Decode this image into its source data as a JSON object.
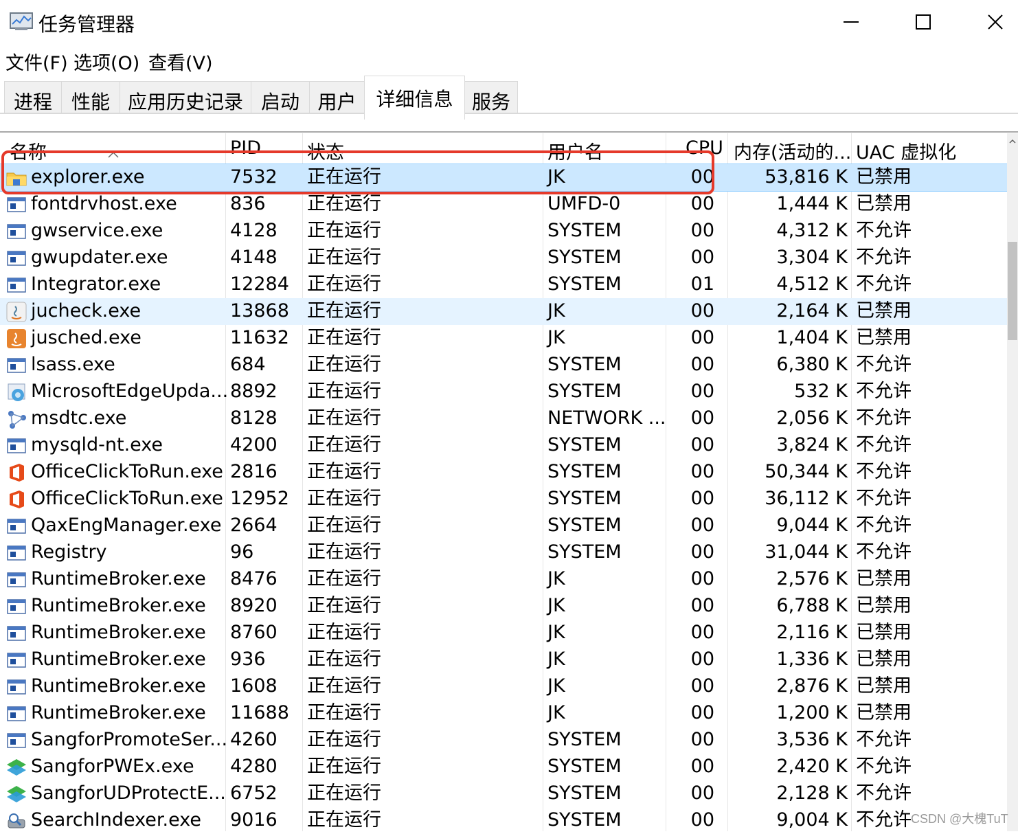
{
  "window": {
    "title": "任务管理器",
    "controls": {
      "minimize": "—",
      "maximize": "☐",
      "close": "✕"
    }
  },
  "menu": [
    "文件(F)",
    "选项(O)",
    "查看(V)"
  ],
  "tabs": [
    {
      "label": "进程",
      "active": false
    },
    {
      "label": "性能",
      "active": false
    },
    {
      "label": "应用历史记录",
      "active": false
    },
    {
      "label": "启动",
      "active": false
    },
    {
      "label": "用户",
      "active": false
    },
    {
      "label": "详细信息",
      "active": true
    },
    {
      "label": "服务",
      "active": false
    }
  ],
  "table": {
    "columns": [
      "名称",
      "PID",
      "状态",
      "用户名",
      "CPU",
      "内存(活动的...",
      "UAC 虚拟化"
    ],
    "sort_column": "名称",
    "sort_direction": "ascending",
    "rows": [
      {
        "icon": "folder-icon",
        "name": "explorer.exe",
        "pid": "7532",
        "status": "正在运行",
        "user": "JK",
        "cpu": "00",
        "mem": "53,816 K",
        "uac": "已禁用",
        "state": "selected"
      },
      {
        "icon": "app-window-icon",
        "name": "fontdrvhost.exe",
        "pid": "836",
        "status": "正在运行",
        "user": "UMFD-0",
        "cpu": "00",
        "mem": "1,444 K",
        "uac": "已禁用",
        "state": ""
      },
      {
        "icon": "app-window-icon",
        "name": "gwservice.exe",
        "pid": "4128",
        "status": "正在运行",
        "user": "SYSTEM",
        "cpu": "00",
        "mem": "4,312 K",
        "uac": "不允许",
        "state": ""
      },
      {
        "icon": "app-window-icon",
        "name": "gwupdater.exe",
        "pid": "4148",
        "status": "正在运行",
        "user": "SYSTEM",
        "cpu": "00",
        "mem": "3,304 K",
        "uac": "不允许",
        "state": ""
      },
      {
        "icon": "app-window-icon",
        "name": "Integrator.exe",
        "pid": "12284",
        "status": "正在运行",
        "user": "SYSTEM",
        "cpu": "01",
        "mem": "4,512 K",
        "uac": "不允许",
        "state": ""
      },
      {
        "icon": "java-icon",
        "name": "jucheck.exe",
        "pid": "13868",
        "status": "正在运行",
        "user": "JK",
        "cpu": "00",
        "mem": "2,164 K",
        "uac": "已禁用",
        "state": "hover"
      },
      {
        "icon": "java-orange-icon",
        "name": "jusched.exe",
        "pid": "11632",
        "status": "正在运行",
        "user": "JK",
        "cpu": "00",
        "mem": "1,404 K",
        "uac": "已禁用",
        "state": ""
      },
      {
        "icon": "app-window-icon",
        "name": "lsass.exe",
        "pid": "684",
        "status": "正在运行",
        "user": "SYSTEM",
        "cpu": "00",
        "mem": "6,380 K",
        "uac": "不允许",
        "state": ""
      },
      {
        "icon": "edge-update-icon",
        "name": "MicrosoftEdgeUpda...",
        "pid": "8892",
        "status": "正在运行",
        "user": "SYSTEM",
        "cpu": "00",
        "mem": "532 K",
        "uac": "不允许",
        "state": ""
      },
      {
        "icon": "network-icon",
        "name": "msdtc.exe",
        "pid": "8128",
        "status": "正在运行",
        "user": "NETWORK ...",
        "cpu": "00",
        "mem": "2,056 K",
        "uac": "不允许",
        "state": ""
      },
      {
        "icon": "app-window-icon",
        "name": "mysqld-nt.exe",
        "pid": "4200",
        "status": "正在运行",
        "user": "SYSTEM",
        "cpu": "00",
        "mem": "3,824 K",
        "uac": "不允许",
        "state": ""
      },
      {
        "icon": "office-icon",
        "name": "OfficeClickToRun.exe",
        "pid": "2816",
        "status": "正在运行",
        "user": "SYSTEM",
        "cpu": "00",
        "mem": "50,344 K",
        "uac": "不允许",
        "state": ""
      },
      {
        "icon": "office-icon",
        "name": "OfficeClickToRun.exe",
        "pid": "12952",
        "status": "正在运行",
        "user": "SYSTEM",
        "cpu": "00",
        "mem": "36,112 K",
        "uac": "不允许",
        "state": ""
      },
      {
        "icon": "app-window-icon",
        "name": "QaxEngManager.exe",
        "pid": "2664",
        "status": "正在运行",
        "user": "SYSTEM",
        "cpu": "00",
        "mem": "9,044 K",
        "uac": "不允许",
        "state": ""
      },
      {
        "icon": "app-window-icon",
        "name": "Registry",
        "pid": "96",
        "status": "正在运行",
        "user": "SYSTEM",
        "cpu": "00",
        "mem": "31,044 K",
        "uac": "不允许",
        "state": ""
      },
      {
        "icon": "app-window-icon",
        "name": "RuntimeBroker.exe",
        "pid": "8476",
        "status": "正在运行",
        "user": "JK",
        "cpu": "00",
        "mem": "2,576 K",
        "uac": "已禁用",
        "state": ""
      },
      {
        "icon": "app-window-icon",
        "name": "RuntimeBroker.exe",
        "pid": "8920",
        "status": "正在运行",
        "user": "JK",
        "cpu": "00",
        "mem": "6,788 K",
        "uac": "已禁用",
        "state": ""
      },
      {
        "icon": "app-window-icon",
        "name": "RuntimeBroker.exe",
        "pid": "8760",
        "status": "正在运行",
        "user": "JK",
        "cpu": "00",
        "mem": "2,116 K",
        "uac": "已禁用",
        "state": ""
      },
      {
        "icon": "app-window-icon",
        "name": "RuntimeBroker.exe",
        "pid": "936",
        "status": "正在运行",
        "user": "JK",
        "cpu": "00",
        "mem": "1,336 K",
        "uac": "已禁用",
        "state": ""
      },
      {
        "icon": "app-window-icon",
        "name": "RuntimeBroker.exe",
        "pid": "1608",
        "status": "正在运行",
        "user": "JK",
        "cpu": "00",
        "mem": "2,876 K",
        "uac": "已禁用",
        "state": ""
      },
      {
        "icon": "app-window-icon",
        "name": "RuntimeBroker.exe",
        "pid": "11688",
        "status": "正在运行",
        "user": "JK",
        "cpu": "00",
        "mem": "1,200 K",
        "uac": "已禁用",
        "state": ""
      },
      {
        "icon": "app-window-icon",
        "name": "SangforPromoteSer...",
        "pid": "4260",
        "status": "正在运行",
        "user": "SYSTEM",
        "cpu": "00",
        "mem": "3,536 K",
        "uac": "不允许",
        "state": ""
      },
      {
        "icon": "sangfor-icon",
        "name": "SangforPWEx.exe",
        "pid": "4280",
        "status": "正在运行",
        "user": "SYSTEM",
        "cpu": "00",
        "mem": "2,420 K",
        "uac": "不允许",
        "state": ""
      },
      {
        "icon": "sangfor-icon",
        "name": "SangforUDProtectE...",
        "pid": "6752",
        "status": "正在运行",
        "user": "SYSTEM",
        "cpu": "00",
        "mem": "2,128 K",
        "uac": "不允许",
        "state": ""
      },
      {
        "icon": "search-indexer-icon",
        "name": "SearchIndexer.exe",
        "pid": "9016",
        "status": "正在运行",
        "user": "SYSTEM",
        "cpu": "00",
        "mem": "9,004 K",
        "uac": "不允许",
        "state": ""
      }
    ]
  },
  "colors": {
    "selected_row": "#cce8ff",
    "hover_row": "#e5f3ff",
    "annotation": "#e5392a"
  },
  "watermark": "CSDN @大槐TuT"
}
